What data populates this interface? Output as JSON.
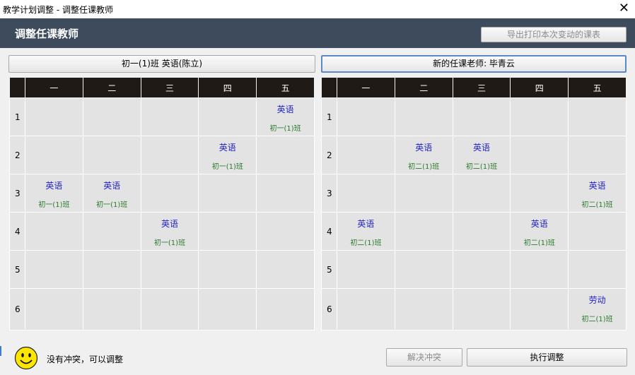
{
  "window": {
    "title": "教学计划调整 - 调整任课教师",
    "close_glyph": "✕"
  },
  "header": {
    "title": "调整任课教师",
    "export_button": "导出打印本次变动的课表"
  },
  "left_panel": {
    "title": "初一(1)班 英语(陈立)"
  },
  "right_panel": {
    "title": "新的任课老师: 毕青云"
  },
  "days": [
    "一",
    "二",
    "三",
    "四",
    "五"
  ],
  "periods": [
    "1",
    "2",
    "3",
    "4",
    "5",
    "6"
  ],
  "left_grid": [
    [
      null,
      null,
      null,
      null,
      {
        "subject": "英语",
        "class": "初一(1)班"
      }
    ],
    [
      null,
      null,
      null,
      {
        "subject": "英语",
        "class": "初一(1)班"
      },
      null
    ],
    [
      {
        "subject": "英语",
        "class": "初一(1)班"
      },
      {
        "subject": "英语",
        "class": "初一(1)班"
      },
      null,
      null,
      null
    ],
    [
      null,
      null,
      {
        "subject": "英语",
        "class": "初一(1)班"
      },
      null,
      null
    ],
    [
      null,
      null,
      null,
      null,
      null
    ],
    [
      null,
      null,
      null,
      null,
      null
    ]
  ],
  "right_grid": [
    [
      null,
      null,
      null,
      null,
      null
    ],
    [
      null,
      {
        "subject": "英语",
        "class": "初二(1)班"
      },
      {
        "subject": "英语",
        "class": "初二(1)班"
      },
      null,
      null
    ],
    [
      null,
      null,
      null,
      null,
      {
        "subject": "英语",
        "class": "初二(1)班"
      }
    ],
    [
      {
        "subject": "英语",
        "class": "初二(1)班"
      },
      null,
      null,
      {
        "subject": "英语",
        "class": "初二(1)班"
      },
      null
    ],
    [
      null,
      null,
      null,
      null,
      null
    ],
    [
      null,
      null,
      null,
      null,
      {
        "subject": "劳动",
        "class": "初二(1)班"
      }
    ]
  ],
  "footer": {
    "status": "没有冲突，可以调整",
    "resolve_button": "解决冲突",
    "execute_button": "执行调整",
    "icon": "smiley-icon"
  },
  "colors": {
    "header_bg": "#3d4b5c",
    "grid_header_bg": "#201a16",
    "subject": "#2222cc",
    "class": "#2a7a2a"
  }
}
